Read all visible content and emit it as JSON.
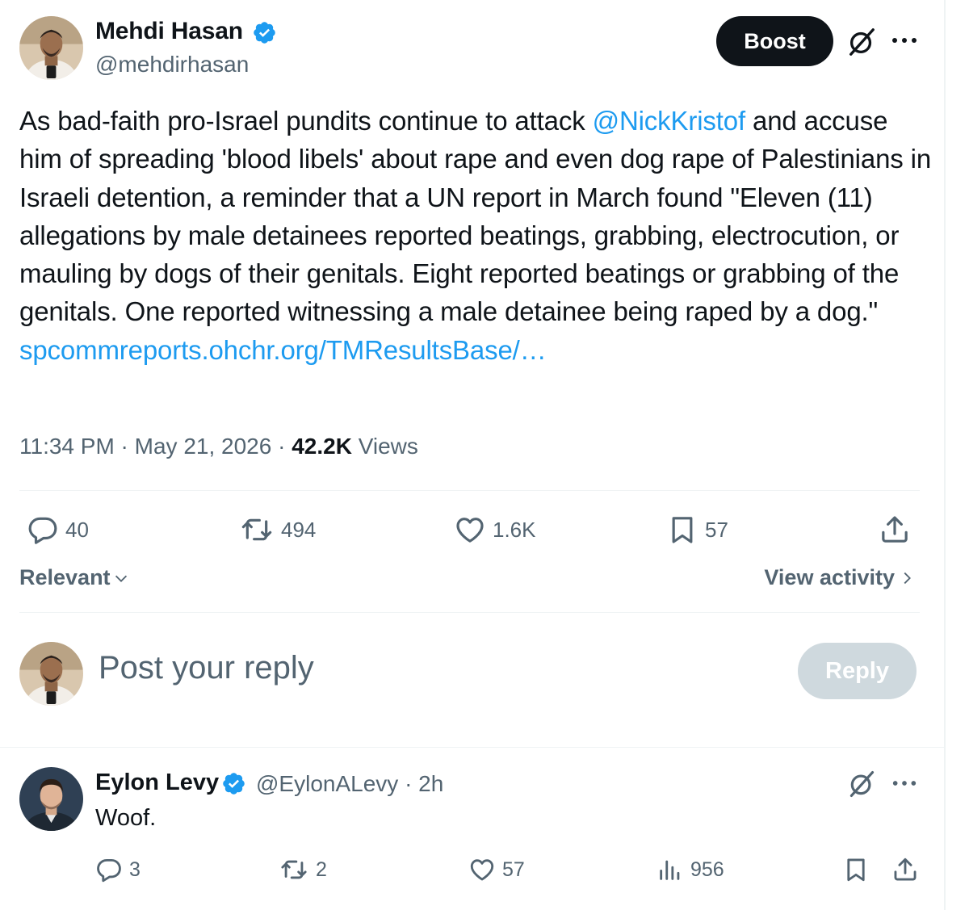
{
  "tweet": {
    "author_name": "Mehdi Hasan",
    "author_handle": "@mehdirhasan",
    "boost_label": "Boost",
    "text_before": "As bad-faith pro-Israel pundits continue to attack ",
    "mention": "@NickKristof",
    "text_after": " and accuse him of spreading 'blood libels' about rape and even dog rape of Palestinians in Israeli detention, a reminder that a UN report in March found \"Eleven (11) allegations by male detainees reported beatings, grabbing, electrocution, or mauling by dogs of their genitals. Eight reported beatings or grabbing of the genitals. One reported witnessing a male detainee being raped by a dog.\"",
    "link": "spcommreports.ohchr.org/TMResultsBase/…",
    "time": "11:34 PM · May 21, 2026 · ",
    "views_count": "42.2K",
    "views_label": " Views",
    "stats": {
      "replies": "40",
      "reposts": "494",
      "likes": "1.6K",
      "bookmarks": "57"
    }
  },
  "sort": {
    "label": "Relevant"
  },
  "activity": {
    "label": "View activity"
  },
  "composer": {
    "placeholder": "Post your reply",
    "reply_label": "Reply"
  },
  "reply": {
    "author_name": "Eylon Levy",
    "meta": "@EylonALevy · 2h",
    "text": "Woof.",
    "stats": {
      "replies": "3",
      "reposts": "2",
      "likes": "57",
      "views": "956"
    }
  },
  "icons": {
    "verified": "verified-badge-icon",
    "grok": "grok-icon",
    "more": "more-icon",
    "reply": "reply-icon",
    "repost": "repost-icon",
    "like": "heart-icon",
    "bookmark": "bookmark-icon",
    "share": "share-icon",
    "views": "views-icon",
    "chevron_down": "chevron-down-icon",
    "chevron_right": "chevron-right-icon"
  },
  "colors": {
    "accent": "#1d9bf0",
    "text": "#0f1419",
    "muted": "#536471",
    "reply_disabled": "#cfd9de",
    "boost": "#0f1419"
  }
}
